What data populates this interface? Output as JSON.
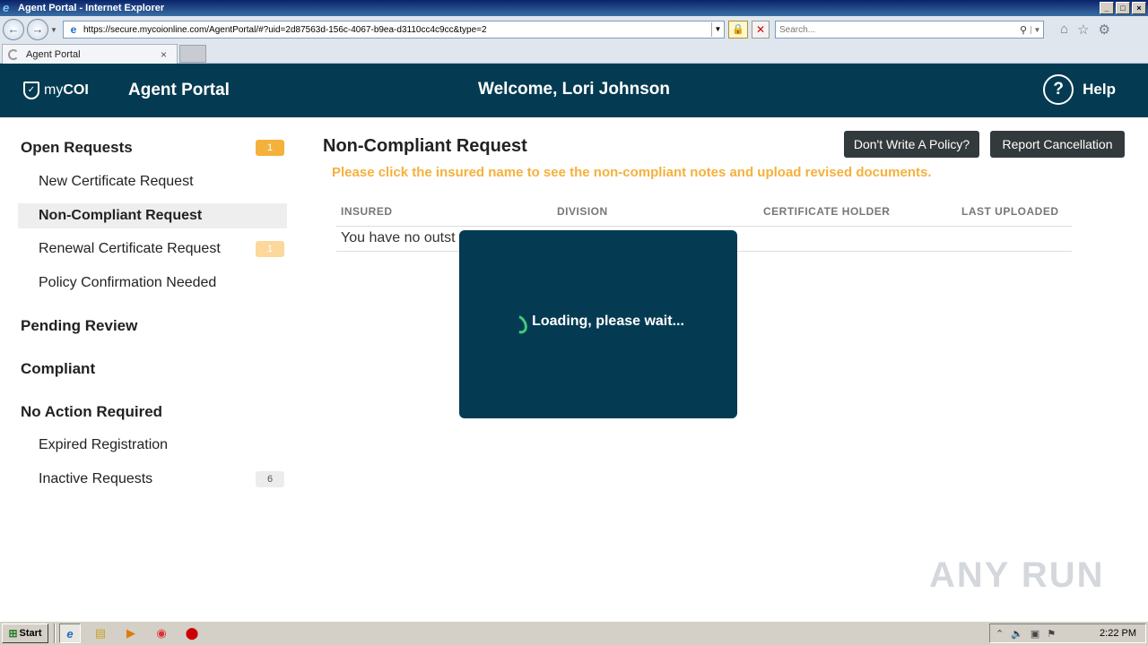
{
  "browser": {
    "window_title": "Agent Portal - Internet Explorer",
    "url": "https://secure.mycoionline.com/AgentPortal/#?uid=2d87563d-156c-4067-b9ea-d3110cc4c9cc&type=2",
    "search_placeholder": "Search...",
    "tab_label": "Agent Portal"
  },
  "header": {
    "brand_prefix": "my",
    "brand_suffix": "COI",
    "portal_title": "Agent Portal",
    "welcome": "Welcome, Lori Johnson",
    "help_symbol": "?",
    "help_label": "Help"
  },
  "sidebar": {
    "open_requests": {
      "label": "Open Requests",
      "count": "1"
    },
    "items_open": [
      {
        "label": "New Certificate Request",
        "count": ""
      },
      {
        "label": "Non-Compliant Request",
        "count": ""
      },
      {
        "label": "Renewal Certificate Request",
        "count": "1"
      },
      {
        "label": "Policy Confirmation Needed",
        "count": ""
      }
    ],
    "pending_review": "Pending Review",
    "compliant": "Compliant",
    "no_action": "No Action Required",
    "items_no_action": [
      {
        "label": "Expired Registration",
        "count": ""
      },
      {
        "label": "Inactive Requests",
        "count": "6"
      }
    ]
  },
  "main": {
    "title": "Non-Compliant Request",
    "btn_no_policy": "Don't Write A Policy?",
    "btn_cancellation": "Report Cancellation",
    "instruction": "Please click the insured name to see the non-compliant notes and upload revised documents.",
    "columns": [
      "INSURED",
      "DIVISION",
      "CERTIFICATE HOLDER",
      "LAST UPLOADED"
    ],
    "empty_row": "You have no outst"
  },
  "loading": {
    "text": "Loading, please wait..."
  },
  "watermark": "ANY RUN",
  "taskbar": {
    "start_label": "Start",
    "clock": "2:22 PM"
  },
  "colors": {
    "header_bg": "#043b52",
    "accent_orange": "#f4b13c",
    "button_dark": "#333a3d",
    "spinner_green": "#3fcc7a"
  }
}
